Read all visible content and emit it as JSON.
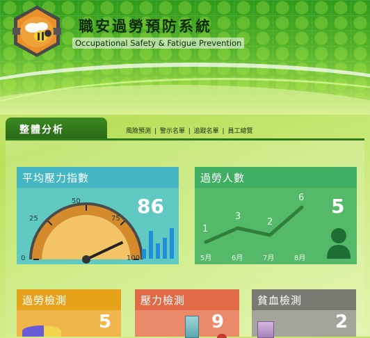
{
  "app": {
    "title": "職安過勞預防系統",
    "subtitle": "Occupational Safety & Fatigue Prevention"
  },
  "section": {
    "title": "整體分析"
  },
  "nav": {
    "items": [
      {
        "label": "風險預測"
      },
      {
        "label": "警示名單"
      },
      {
        "label": "追蹤名單"
      },
      {
        "label": "員工總覽"
      }
    ],
    "separator": "|"
  },
  "stress_card": {
    "title": "平均壓力指數",
    "value": "86",
    "gauge_value": 86,
    "ticks": [
      "0",
      "25",
      "50",
      "75",
      "100"
    ],
    "color": "#4bbfc0"
  },
  "overwork_card": {
    "title": "過勞人數",
    "value": "5",
    "color": "#3fae62",
    "trend": {
      "months": [
        "5月",
        "6月",
        "7月",
        "8月"
      ],
      "values": [
        1,
        3,
        2,
        6
      ],
      "value_labels": [
        "1",
        "3",
        "2",
        "6"
      ]
    }
  },
  "bottom_cards": [
    {
      "title": "過勞檢測",
      "value": "5",
      "color": "#e7a21c"
    },
    {
      "title": "壓力檢測",
      "value": "9",
      "color": "#e06a48"
    },
    {
      "title": "貧血檢測",
      "value": "2",
      "color": "#7a7a72"
    }
  ]
}
